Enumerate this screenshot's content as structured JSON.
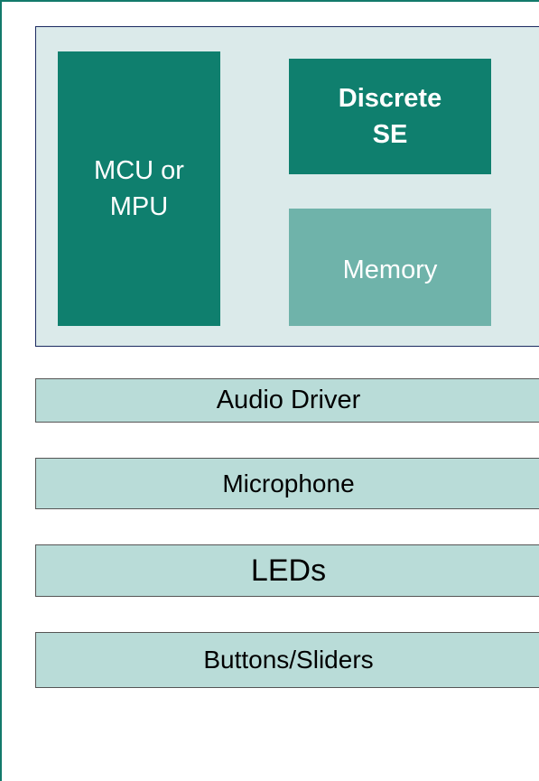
{
  "diagram": {
    "blocks": {
      "mcu": "MCU or\nMPU",
      "secure_element": "Discrete\nSE",
      "memory": "Memory"
    },
    "peripherals": [
      "Audio Driver",
      "Microphone",
      "LEDs",
      "Buttons/Sliders"
    ]
  },
  "colors": {
    "dark_teal": "#0f7f6e",
    "light_teal": "#6fb3aa",
    "panel_bg": "#dbeaea",
    "bar_bg": "#b9dcd8"
  }
}
